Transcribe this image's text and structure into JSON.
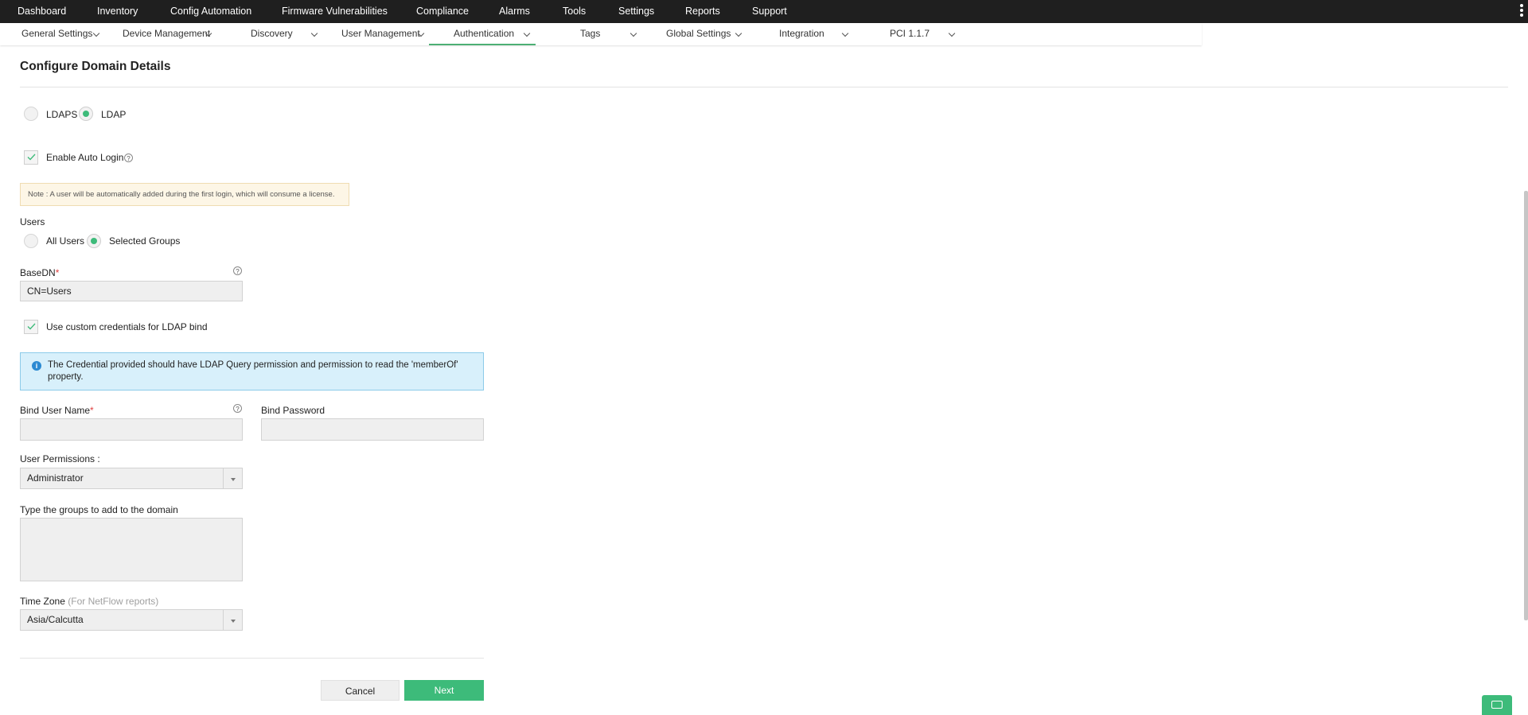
{
  "topnav": {
    "items": [
      "Dashboard",
      "Inventory",
      "Config Automation",
      "Firmware Vulnerabilities",
      "Compliance",
      "Alarms",
      "Tools",
      "Settings",
      "Reports",
      "Support"
    ],
    "more_icon": "vertical-dots-icon"
  },
  "subnav": {
    "items": [
      "General Settings",
      "Device Management",
      "Discovery",
      "User Management",
      "Authentication",
      "Tags",
      "Global Settings",
      "Integration",
      "PCI 1.1.7"
    ],
    "active": "Authentication",
    "accent_color": "#4caf74"
  },
  "page": {
    "title": "Configure Domain Details"
  },
  "protocol": {
    "options": [
      "LDAPS",
      "LDAP"
    ],
    "selected": "LDAP"
  },
  "auto_login": {
    "label": "Enable Auto Login",
    "checked": true,
    "help": "?"
  },
  "note": "Note : A user will be automatically added during the first login, which will consume a license.",
  "users": {
    "label": "Users",
    "options": [
      "All Users",
      "Selected Groups"
    ],
    "selected": "Selected Groups"
  },
  "basedn": {
    "label": "BaseDN",
    "required_mark": "*",
    "value": "CN=Users",
    "help": "?"
  },
  "custom_credentials": {
    "label": "Use custom credentials for LDAP bind",
    "checked": true
  },
  "info": {
    "icon": "info-icon",
    "text": "The Credential provided should have LDAP Query permission and permission to read the 'memberOf' property."
  },
  "bind_user": {
    "label": "Bind User Name",
    "required_mark": "*",
    "value": "",
    "help": "?"
  },
  "bind_password": {
    "label": "Bind Password",
    "value": ""
  },
  "user_permissions": {
    "label": "User Permissions :",
    "value": "Administrator"
  },
  "groups": {
    "label": "Type the groups to add to the domain",
    "value": ""
  },
  "timezone": {
    "label": "Time Zone",
    "hint": "(For NetFlow reports)",
    "value": "Asia/Calcutta"
  },
  "buttons": {
    "cancel": "Cancel",
    "next": "Next"
  },
  "colors": {
    "topbar": "#1f1f1f",
    "primary": "#3dbb7a",
    "info_bg": "#d8f0fb",
    "note_bg": "#fdf6e6"
  }
}
